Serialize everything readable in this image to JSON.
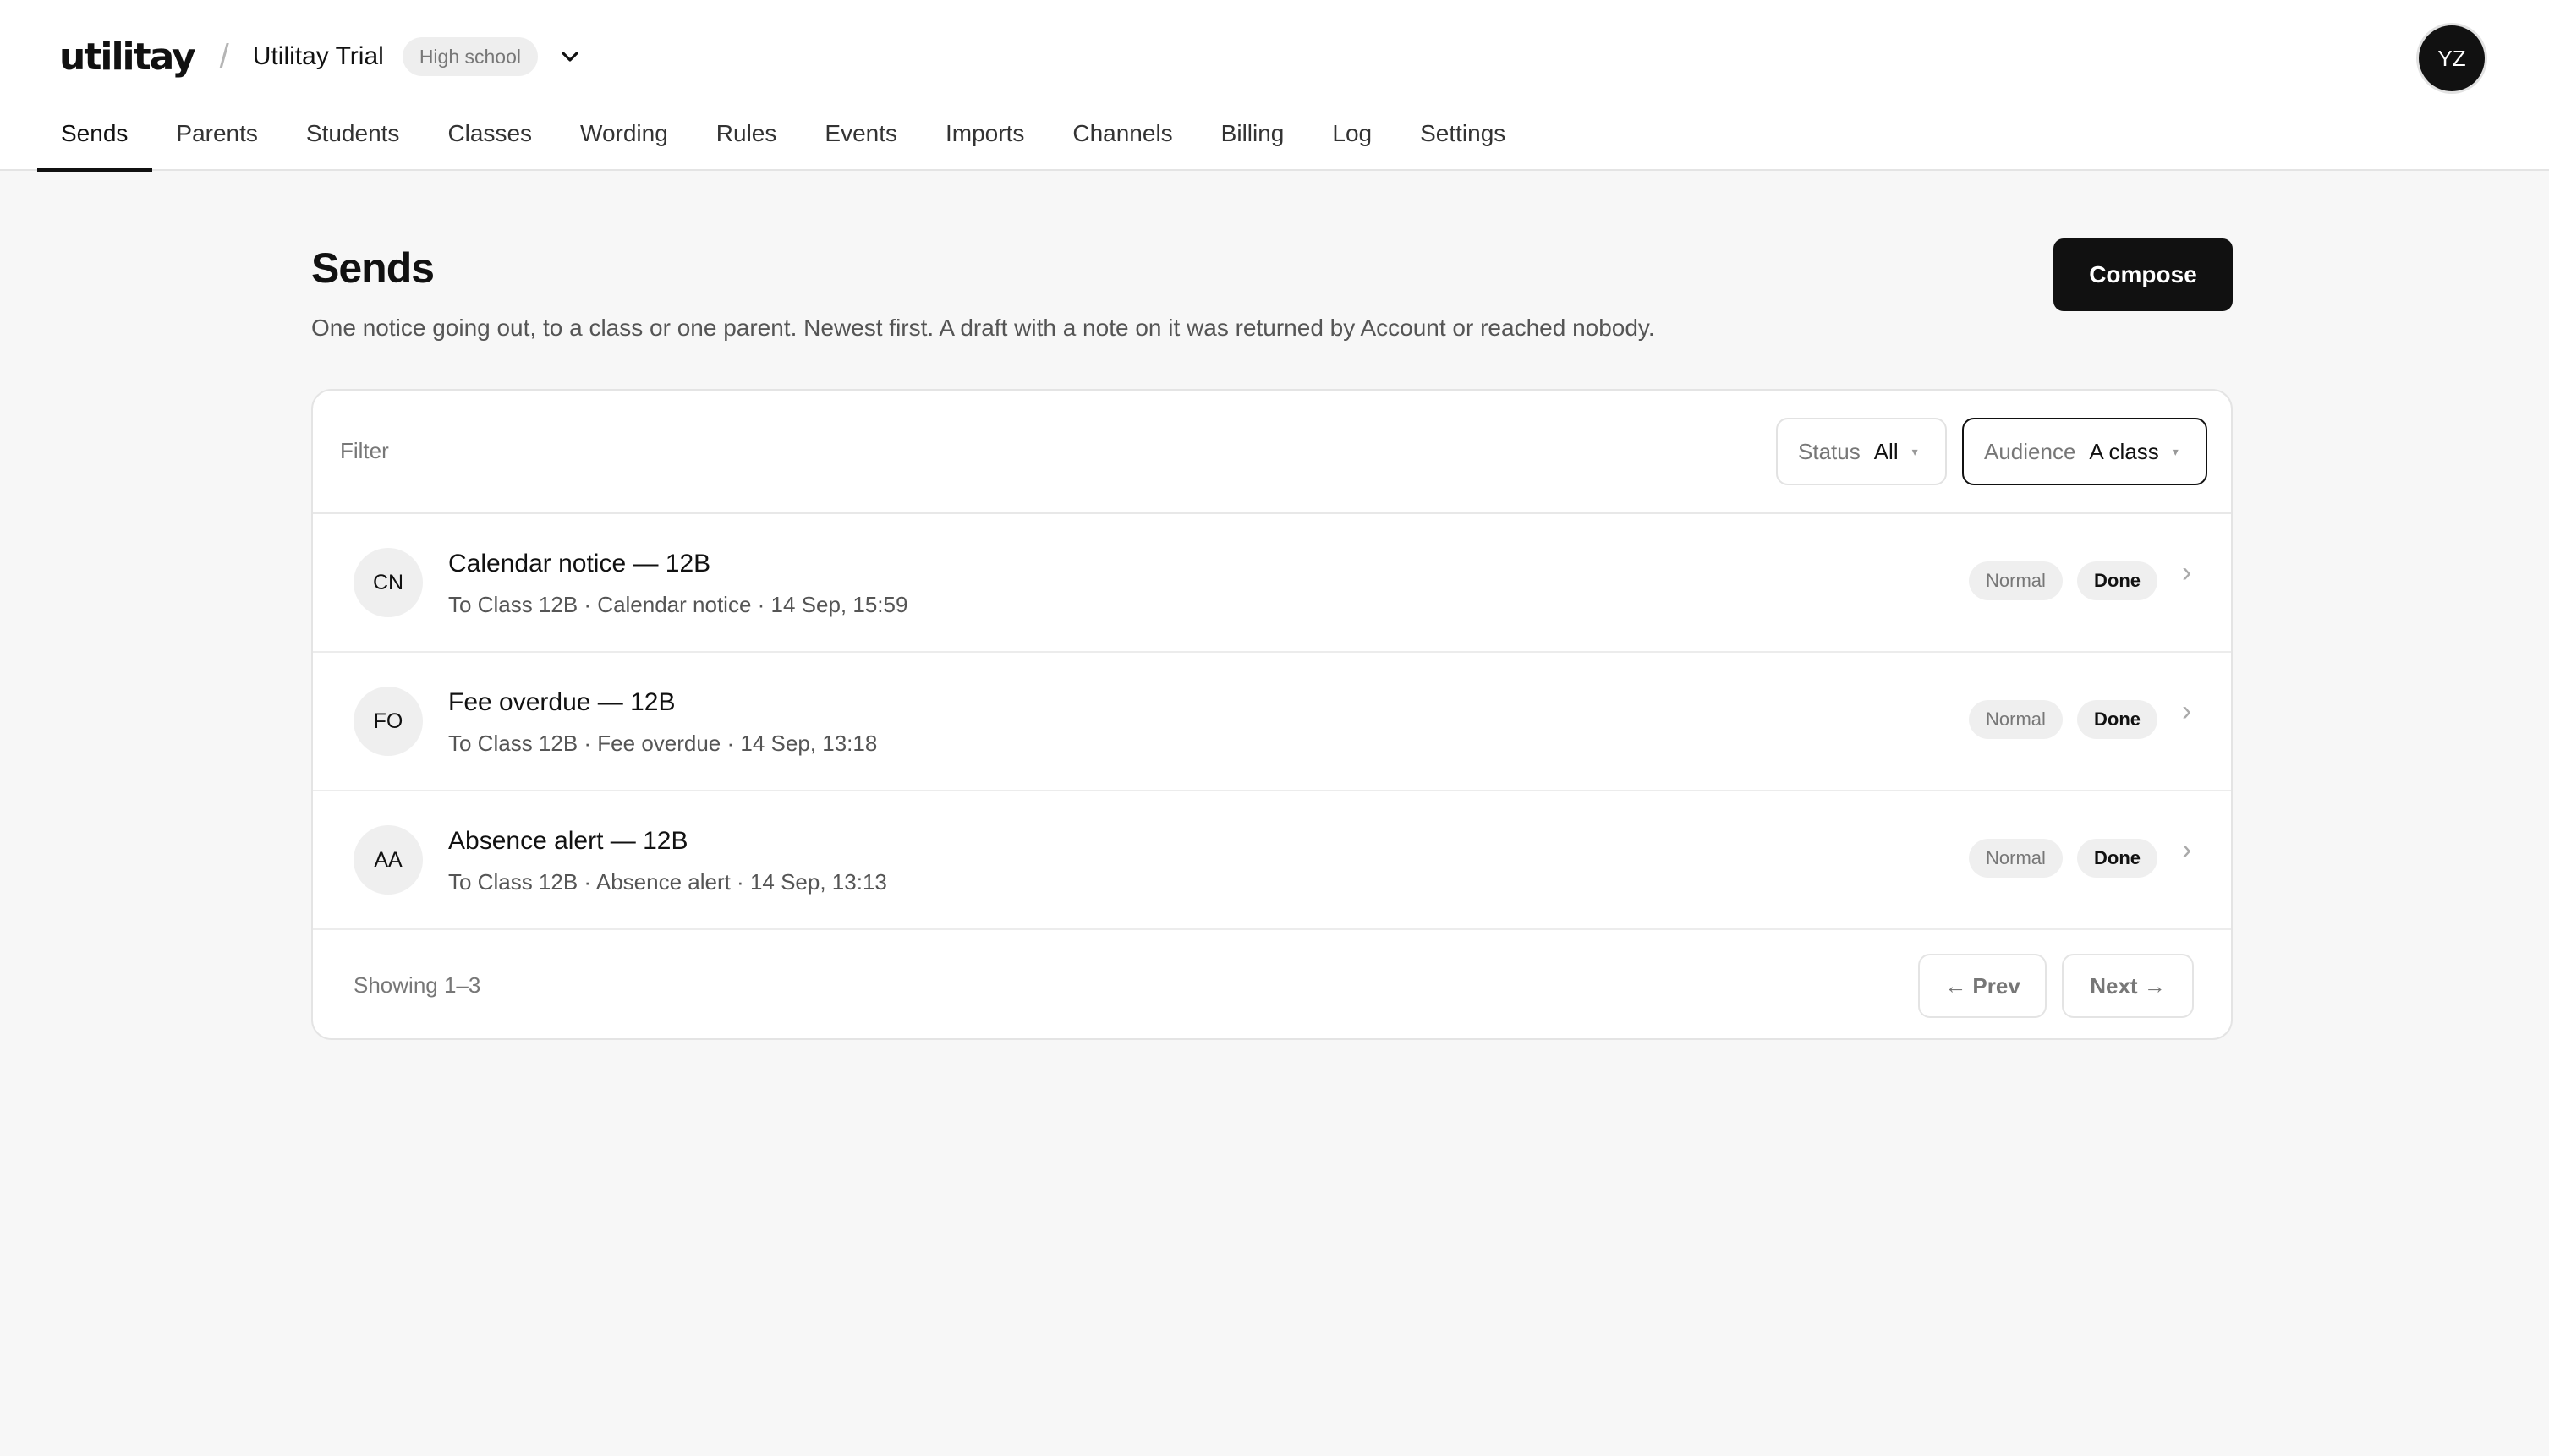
{
  "brand": {
    "logo_text": "utilitay",
    "separator": "/",
    "org_name": "Utilitay Trial",
    "org_badge": "High school",
    "org_switch_icon": "chevron-down-icon"
  },
  "user": {
    "initials": "YZ"
  },
  "nav": {
    "items": [
      {
        "label": "Sends",
        "active": true
      },
      {
        "label": "Parents"
      },
      {
        "label": "Students"
      },
      {
        "label": "Classes"
      },
      {
        "label": "Wording"
      },
      {
        "label": "Rules"
      },
      {
        "label": "Events"
      },
      {
        "label": "Imports"
      },
      {
        "label": "Channels"
      },
      {
        "label": "Billing"
      },
      {
        "label": "Log"
      },
      {
        "label": "Settings"
      }
    ]
  },
  "page": {
    "title": "Sends",
    "description": "One notice going out, to a class or one parent. Newest first. A draft with a note on it was returned by Account or reached nobody.",
    "compose_label": "Compose"
  },
  "filters": {
    "label": "Filter",
    "status": {
      "label": "Status",
      "value": "All"
    },
    "audience": {
      "label": "Audience",
      "value": "A class"
    },
    "caret": "▾"
  },
  "sends": [
    {
      "initials": "CN",
      "title": "Calendar notice — 12B",
      "meta": "To Class 12B · Calendar notice · 14 Sep, 15:59",
      "priority": "Normal",
      "status": "Done"
    },
    {
      "initials": "FO",
      "title": "Fee overdue — 12B",
      "meta": "To Class 12B · Fee overdue · 14 Sep, 13:18",
      "priority": "Normal",
      "status": "Done"
    },
    {
      "initials": "AA",
      "title": "Absence alert — 12B",
      "meta": "To Class 12B · Absence alert · 14 Sep, 13:13",
      "priority": "Normal",
      "status": "Done"
    }
  ],
  "row_chevron": "›",
  "pagination": {
    "showing": "Showing 1–3",
    "prev_label": "← Prev",
    "next_label": "Next →"
  },
  "colors": {
    "background": "#f7f7f7",
    "surface": "#ffffff",
    "primary": "#111111",
    "muted_text": "#777777",
    "pill_bg": "#efefef",
    "border": "#e4e4e4"
  }
}
